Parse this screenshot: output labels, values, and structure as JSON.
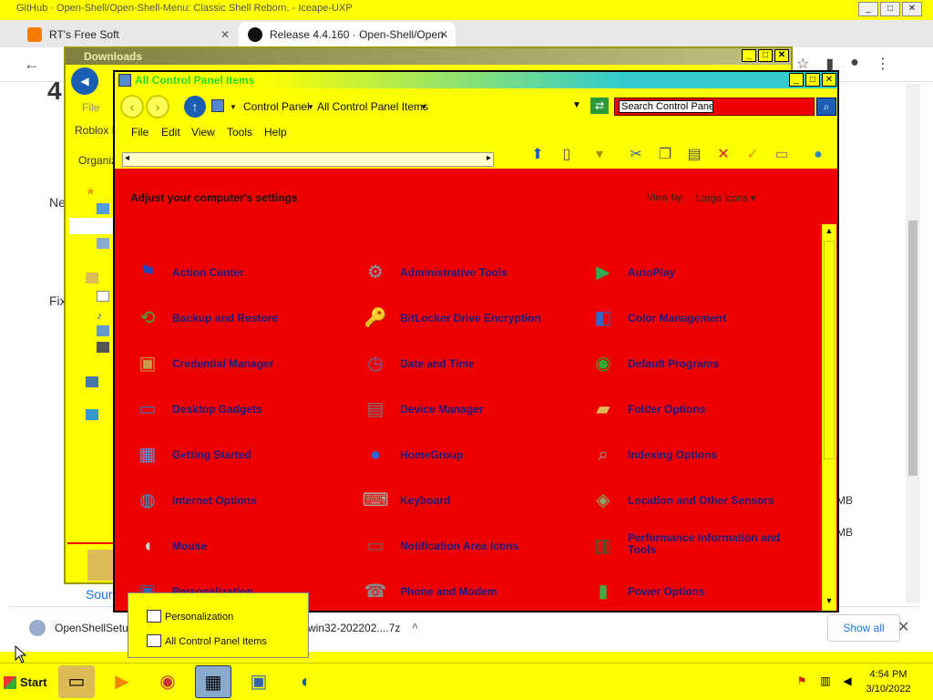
{
  "browser": {
    "window_title": "GitHub · Open-Shell/Open-Shell-Menu: Classic Shell Reborn. - Iceape-UXP",
    "tabs": [
      {
        "label": "RT's Free Soft"
      },
      {
        "label": "Release 4.4.160 · Open-Shell/Open-"
      }
    ],
    "new_tab": "+",
    "bg_texts": [
      "4",
      "Ne",
      "Fix",
      "Sour",
      "MB",
      "MB"
    ],
    "downloads_bar": {
      "item1": "OpenShellSetu",
      "item2": "win32-202202....7z",
      "show_all": "Show all",
      "close": "✕"
    }
  },
  "downloads_window": {
    "title": "Downloads",
    "sidebar": {
      "file_label": "File",
      "favorite_label": "Roblox F",
      "organize_label": "Organiz"
    }
  },
  "control_panel": {
    "title": "All Control Panel Items",
    "breadcrumb": [
      "Control Panel",
      "All Control Panel Items"
    ],
    "search_placeholder": "Search Control Panel",
    "menu": [
      "File",
      "Edit",
      "View",
      "Tools",
      "Help"
    ],
    "heading": "Adjust your computer's settings",
    "view_by_label": "View by:",
    "view_by_value": "Large icons",
    "items": [
      {
        "label": "Action Center",
        "icon": "flag-icon",
        "color": "#2244bb",
        "glyph": "⚑"
      },
      {
        "label": "Administrative Tools",
        "icon": "gears-icon",
        "color": "#8899aa",
        "glyph": "⚙"
      },
      {
        "label": "AutoPlay",
        "icon": "autoplay-icon",
        "color": "#33aa55",
        "glyph": "▶"
      },
      {
        "label": "Backup and Restore",
        "icon": "backup-icon",
        "color": "#44aa44",
        "glyph": "⟲"
      },
      {
        "label": "BitLocker Drive Encryption",
        "icon": "bitlocker-icon",
        "color": "#ccaa44",
        "glyph": "🔑"
      },
      {
        "label": "Color Management",
        "icon": "color-management-icon",
        "color": "#3366cc",
        "glyph": "◧"
      },
      {
        "label": "Credential Manager",
        "icon": "credential-icon",
        "color": "#cc9944",
        "glyph": "▣"
      },
      {
        "label": "Date and Time",
        "icon": "clock-icon",
        "color": "#5577aa",
        "glyph": "◷"
      },
      {
        "label": "Default Programs",
        "icon": "default-programs-icon",
        "color": "#33aa33",
        "glyph": "◉"
      },
      {
        "label": "Desktop Gadgets",
        "icon": "gadgets-icon",
        "color": "#3377cc",
        "glyph": "▭"
      },
      {
        "label": "Device Manager",
        "icon": "device-manager-icon",
        "color": "#777777",
        "glyph": "▤"
      },
      {
        "label": "Folder Options",
        "icon": "folder-icon",
        "color": "#ddbb55",
        "glyph": "▰"
      },
      {
        "label": "Getting Started",
        "icon": "getting-started-icon",
        "color": "#5599dd",
        "glyph": "▦"
      },
      {
        "label": "HomeGroup",
        "icon": "homegroup-icon",
        "color": "#3366cc",
        "glyph": "●"
      },
      {
        "label": "Indexing Options",
        "icon": "indexing-icon",
        "color": "#999999",
        "glyph": "⌕"
      },
      {
        "label": "Internet Options",
        "icon": "internet-icon",
        "color": "#3399cc",
        "glyph": "◍"
      },
      {
        "label": "Keyboard",
        "icon": "keyboard-icon",
        "color": "#aaaaaa",
        "glyph": "⌨"
      },
      {
        "label": "Location and Other Sensors",
        "icon": "location-icon",
        "color": "#88aa66",
        "glyph": "◈"
      },
      {
        "label": "Mouse",
        "icon": "mouse-icon",
        "color": "#cccccc",
        "glyph": "◖"
      },
      {
        "label": "Notification Area Icons",
        "icon": "notification-icon",
        "color": "#666666",
        "glyph": "▭"
      },
      {
        "label": "Performance Information and Tools",
        "icon": "performance-icon",
        "color": "#336633",
        "glyph": "▥"
      },
      {
        "label": "Personalization",
        "icon": "personalization-icon",
        "color": "#3366aa",
        "glyph": "▣"
      },
      {
        "label": "Phone and Modem",
        "icon": "phone-icon",
        "color": "#888888",
        "glyph": "☎"
      },
      {
        "label": "Power Options",
        "icon": "power-icon",
        "color": "#44aa44",
        "glyph": "▮"
      }
    ]
  },
  "start_popup": {
    "items": [
      "Personalization",
      "All Control Panel Items"
    ]
  },
  "taskbar": {
    "start_label": "Start",
    "time": "4:54 PM",
    "date": "3/10/2022"
  }
}
